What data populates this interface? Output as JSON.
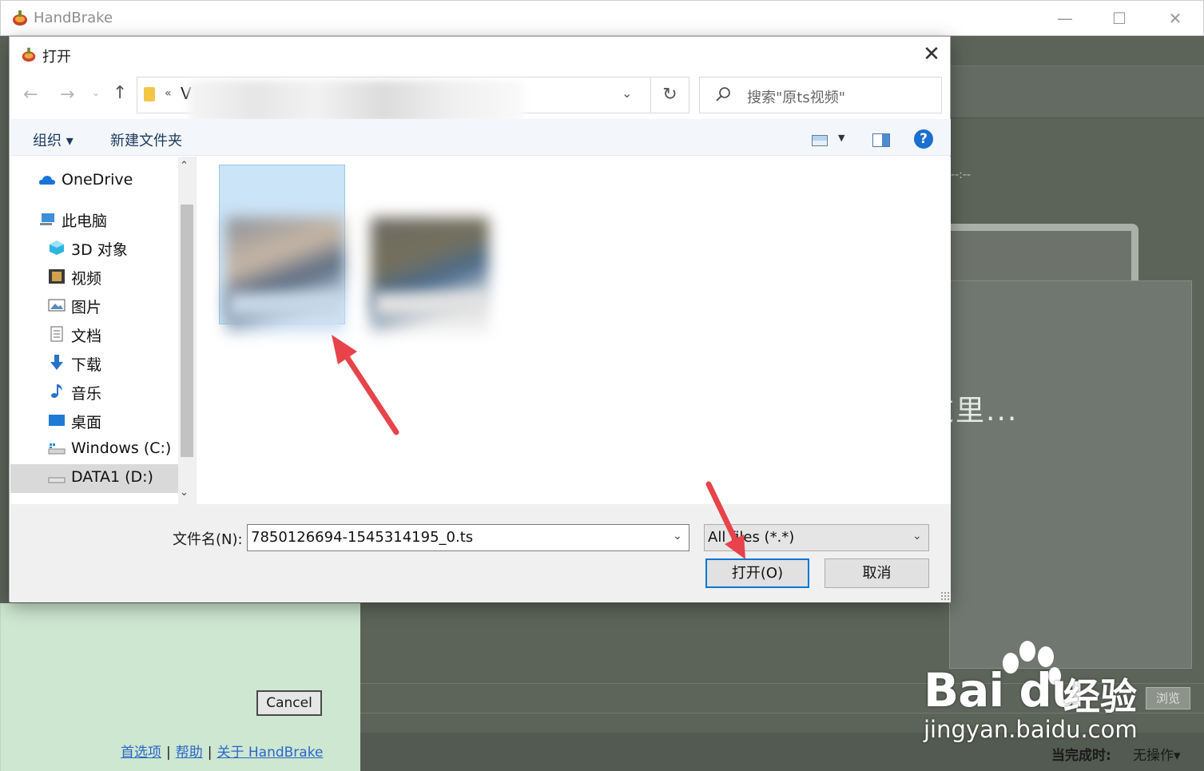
{
  "main_window": {
    "title": "HandBrake",
    "minimize": "—",
    "maximize": "☐",
    "close": "✕",
    "dropzone_text": "这里...",
    "dash_text": "--:--",
    "browse_label": "浏览",
    "when_done_label": "当完成时:",
    "when_done_value": "无操作▾",
    "cancel_label": "Cancel",
    "links": {
      "preferences": "首选项",
      "help": "帮助",
      "about": "关于 HandBrake",
      "separator": "|"
    }
  },
  "dialog": {
    "title": "打开",
    "close": "✕",
    "address": {
      "overflow": "«",
      "path_visible": "V"
    },
    "search_placeholder": "搜索\"原ts视频\"",
    "toolbar": {
      "organize": "组织 ▾",
      "new_folder": "新建文件夹"
    },
    "help_icon": "?",
    "nav_items": [
      {
        "label": "OneDrive",
        "icon": "onedrive-icon"
      },
      {
        "label": "此电脑",
        "icon": "computer-icon"
      },
      {
        "label": "3D 对象",
        "icon": "cube-icon"
      },
      {
        "label": "视频",
        "icon": "video-icon"
      },
      {
        "label": "图片",
        "icon": "picture-icon"
      },
      {
        "label": "文档",
        "icon": "document-icon"
      },
      {
        "label": "下载",
        "icon": "download-icon"
      },
      {
        "label": "音乐",
        "icon": "music-icon"
      },
      {
        "label": "桌面",
        "icon": "desktop-icon"
      },
      {
        "label": "Windows (C:)",
        "icon": "drive-c-icon"
      },
      {
        "label": "DATA1 (D:)",
        "icon": "drive-d-icon"
      }
    ],
    "filename_label": "文件名(N):",
    "filename_value": "7850126694-1545314195_0.ts",
    "filetype_value": "All files (*.*)",
    "open_button": "打开(O)",
    "cancel_button": "取消"
  },
  "watermark": {
    "brand": "Bai du",
    "cn": "经验",
    "url": "jingyan.baidu.com"
  },
  "colors": {
    "accent": "#0078d7",
    "annotation_arrow": "#e8434a",
    "handbrake_panel": "#cde7d1"
  }
}
